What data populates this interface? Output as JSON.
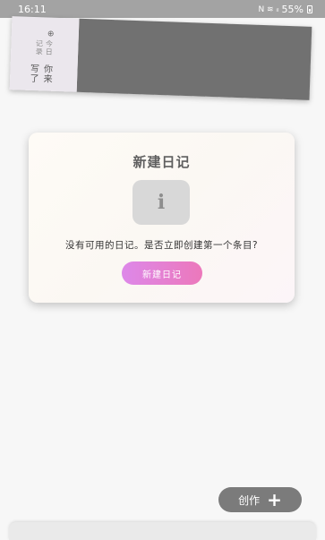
{
  "status_bar": {
    "time": "16:11",
    "icons": [
      "mute-icon",
      "wifi-icon",
      "signal-icon"
    ],
    "signal_text": "N ≋ ᵢₗ",
    "battery": "55%"
  },
  "banner": {
    "subtitle": "今日记录",
    "title": "你来写了",
    "logo_glyph": "⊕"
  },
  "dialog": {
    "title": "新建日记",
    "info_glyph": "i",
    "message": "没有可用的日记。是否立即创建第一个条目?",
    "button_label": "新建日记",
    "button_gradient": [
      "#dd88e9",
      "#ec78bb"
    ]
  },
  "fab": {
    "label": "创作",
    "plus_glyph": "+"
  }
}
